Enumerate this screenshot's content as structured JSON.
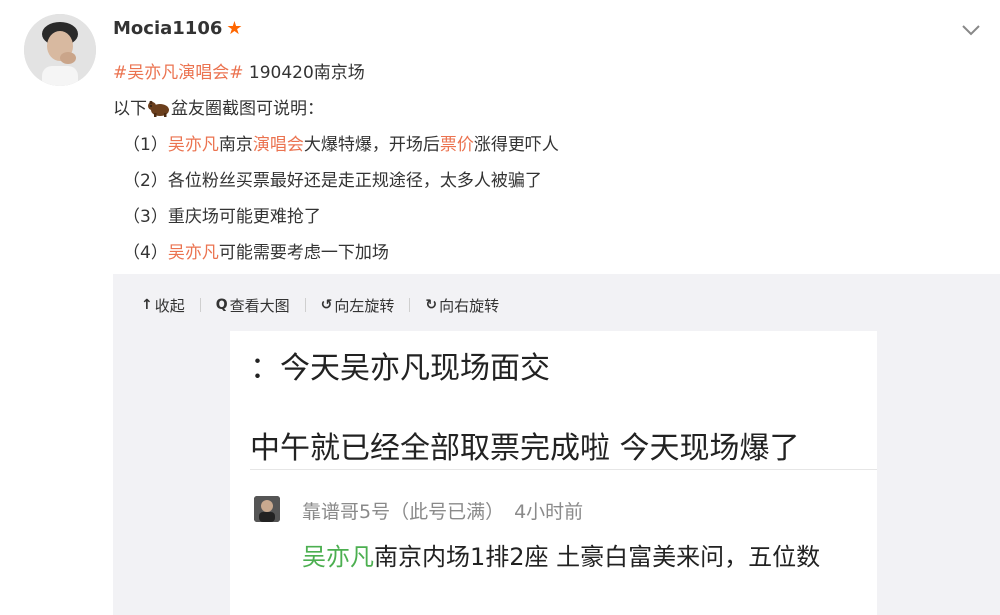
{
  "post": {
    "username": "Mocia1106",
    "topic": "#吴亦凡演唱会#",
    "headline_rest": " 190420南京场",
    "intro_prefix": "以下",
    "intro_suffix": "盆友圈截图可说明：",
    "items": [
      {
        "num": "（1）",
        "parts": [
          {
            "t": "吴亦凡",
            "hl": true
          },
          {
            "t": "南京",
            "hl": false
          },
          {
            "t": "演唱会",
            "hl": true
          },
          {
            "t": "大爆特爆，开场后",
            "hl": false
          },
          {
            "t": "票价",
            "hl": true
          },
          {
            "t": "涨得更吓人",
            "hl": false
          }
        ]
      },
      {
        "num": "（2）",
        "parts": [
          {
            "t": "各位粉丝买票最好还是走正规途径，太多人被骗了",
            "hl": false
          }
        ]
      },
      {
        "num": "（3）",
        "parts": [
          {
            "t": "重庆场可能更难抢了",
            "hl": false
          }
        ]
      },
      {
        "num": "（4）",
        "parts": [
          {
            "t": "吴亦凡",
            "hl": true
          },
          {
            "t": "可能需要考虑一下加场",
            "hl": false
          }
        ]
      }
    ]
  },
  "toolbar": {
    "collapse": "收起",
    "view_large": "查看大图",
    "rotate_left": "向左旋转",
    "rotate_right": "向右旋转"
  },
  "screenshot": {
    "line1": "：今天吴亦凡现场面交",
    "line2": "中午就已经全部取票完成啦 今天现场爆了",
    "comment_author": "靠谱哥5号（此号已满）",
    "comment_time": "4小时前",
    "comment_green": "吴亦凡",
    "comment_rest": "南京内场1排2座 土豪白富美来问，五位数"
  },
  "colors": {
    "topic": "#eb7350",
    "highlight": "#eb7350",
    "vip_star": "#ff6600",
    "comment_link": "#4caf50",
    "panel_bg": "#f2f2f5"
  },
  "icons": {
    "vip": "star-icon",
    "menu": "chevron-down-icon",
    "emoji": "bear-emoji-icon"
  }
}
